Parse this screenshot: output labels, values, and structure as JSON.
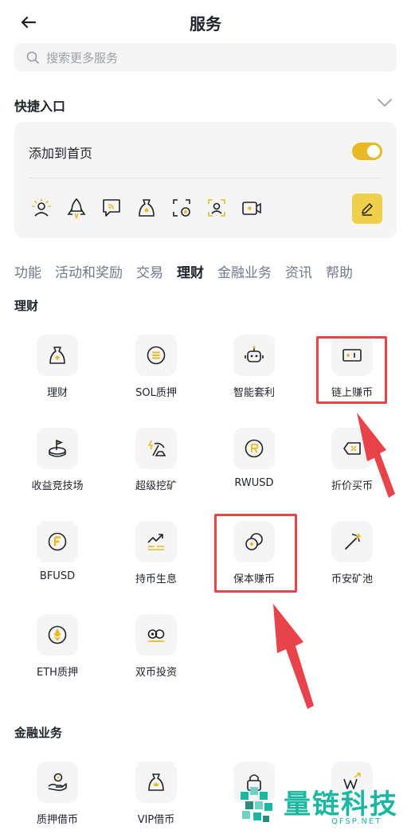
{
  "header": {
    "title": "服务"
  },
  "search": {
    "placeholder": "搜索更多服务"
  },
  "quick_entry": {
    "title": "快捷入口",
    "add_to_home_label": "添加到首页",
    "add_to_home_enabled": true,
    "icons": [
      "sun-person-icon",
      "rocket-icon",
      "broadcast-message-icon",
      "money-bag-icon",
      "scan-coin-icon",
      "scan-user-icon",
      "video-card-icon"
    ]
  },
  "tabs": [
    {
      "label": "功能",
      "active": false
    },
    {
      "label": "活动和奖励",
      "active": false
    },
    {
      "label": "交易",
      "active": false
    },
    {
      "label": "理财",
      "active": true
    },
    {
      "label": "金融业务",
      "active": false
    },
    {
      "label": "资讯",
      "active": false
    },
    {
      "label": "帮助",
      "active": false
    }
  ],
  "sections": {
    "licai": {
      "title": "理财",
      "items": [
        {
          "label": "理财",
          "icon": "money-bag-icon"
        },
        {
          "label": "SOL质押",
          "icon": "sol-coin-icon"
        },
        {
          "label": "智能套利",
          "icon": "robot-icon"
        },
        {
          "label": "链上赚币",
          "icon": "onchain-card-icon",
          "highlighted": true
        },
        {
          "label": "收益竞技场",
          "icon": "arena-flag-icon"
        },
        {
          "label": "超级挖矿",
          "icon": "super-mining-icon"
        },
        {
          "label": "RWUSD",
          "icon": "rwusd-coin-icon"
        },
        {
          "label": "折价买币",
          "icon": "discount-tag-icon"
        },
        {
          "label": "BFUSD",
          "icon": "bfusd-coin-icon"
        },
        {
          "label": "持币生息",
          "icon": "trend-up-icon"
        },
        {
          "label": "保本赚币",
          "icon": "principal-protected-icon",
          "highlighted": true
        },
        {
          "label": "币安矿池",
          "icon": "pickaxe-icon"
        },
        {
          "label": "ETH质押",
          "icon": "eth-coin-icon"
        },
        {
          "label": "双币投资",
          "icon": "dual-coin-icon"
        }
      ]
    },
    "finance": {
      "title": "金融业务",
      "items": [
        {
          "label": "质押借币",
          "icon": "pledge-hand-icon"
        },
        {
          "label": "VIP借币",
          "icon": "vip-bag-icon"
        },
        {
          "label": "",
          "icon": "lock-bag-icon"
        },
        {
          "label": "",
          "icon": "vw-chart-icon"
        }
      ]
    }
  },
  "watermark": {
    "text": "量链科技",
    "sub": "QFSP.NET"
  },
  "colors": {
    "accent": "#e8b923",
    "highlight": "#e8424a",
    "watermark": "#1bb7a3"
  }
}
